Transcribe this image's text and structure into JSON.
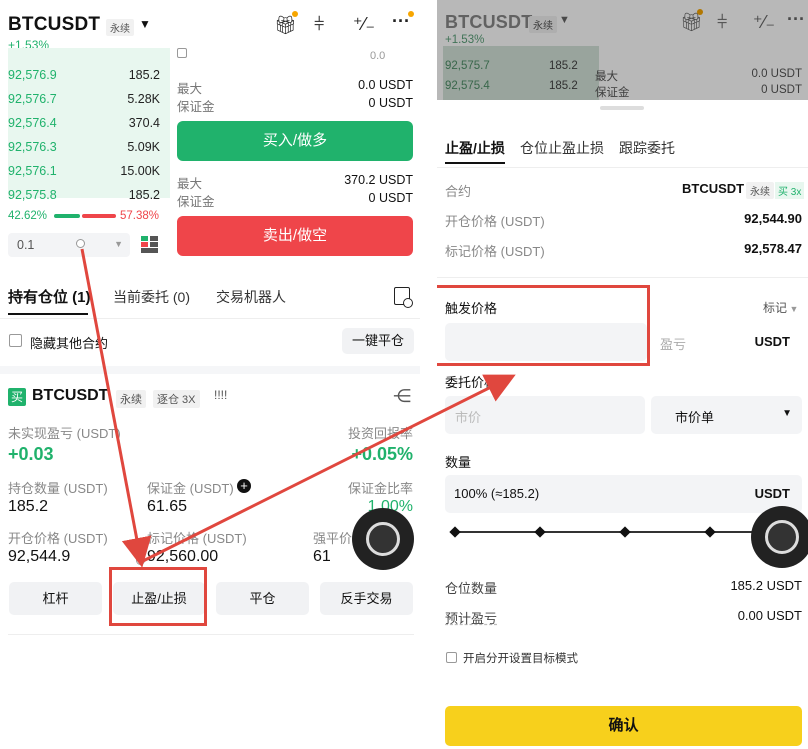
{
  "left": {
    "symbol": "BTCUSDT",
    "contract_tag": "永续",
    "change": "+1.53%",
    "orderbook": [
      {
        "price": "92,576.9",
        "qty": "185.2",
        "depth": 0.5
      },
      {
        "price": "92,576.7",
        "qty": "5.28K",
        "depth": 0.55
      },
      {
        "price": "92,576.4",
        "qty": "370.4",
        "depth": 0.55
      },
      {
        "price": "92,576.3",
        "qty": "5.09K",
        "depth": 0.55
      },
      {
        "price": "92,576.1",
        "qty": "15.00K",
        "depth": 0.55
      },
      {
        "price": "92,575.8",
        "qty": "185.2",
        "depth": 0.5
      }
    ],
    "ratio_buy": "42.62%",
    "ratio_sell": "57.38%",
    "qty_select": "0.1",
    "top_partial": "0.0",
    "max_label": "最大",
    "max_buy": "0.0 USDT",
    "margin_label": "保证金",
    "margin_buy": "0 USDT",
    "buy_button": "买入/做多",
    "max_sell": "370.2 USDT",
    "margin_sell": "0 USDT",
    "sell_button": "卖出/做空",
    "tabs": [
      "持有仓位 (1)",
      "当前委托 (0)",
      "交易机器人"
    ],
    "hide_other": "隐藏其他合约",
    "close_all": "一键平仓",
    "position": {
      "side": "买",
      "symbol": "BTCUSDT",
      "tag1": "永续",
      "tag2": "逐仓 3X",
      "marks": "!!!!",
      "upnl_label": "未实现盈亏 (USDT)",
      "upnl": "+0.03",
      "roe_label": "投资回报率",
      "roe": "+0.05%",
      "size_label": "持仓数量 (USDT)",
      "size": "185.2",
      "margin_label": "保证金 (USDT)",
      "margin": "61.65",
      "margin_ratio_label": "保证金比率",
      "margin_ratio": "1.00%",
      "entry_label": "开仓价格 (USDT)",
      "entry": "92,544.9",
      "mark_label": "标记价格 (USDT)",
      "mark": "92,560.00",
      "liq_label": "强平价格",
      "liq": "61",
      "buttons": [
        "杠杆",
        "止盈/止损",
        "平仓",
        "反手交易"
      ]
    }
  },
  "right": {
    "symbol": "BTCUSDT",
    "contract_tag": "永续",
    "change": "+1.53%",
    "bg_rows": [
      {
        "price": "92,575.7",
        "qty": "185.2",
        "label": "最大",
        "value": "0.0 USDT"
      },
      {
        "price": "92,575.4",
        "qty": "185.2",
        "label": "保证金",
        "value": "0 USDT"
      }
    ],
    "tabs": [
      "止盈/止损",
      "仓位止盈止损",
      "跟踪委托"
    ],
    "contract_label": "合约",
    "contract_value": "BTCUSDT",
    "contract_side": "买 3x",
    "entry_label": "开仓价格 (USDT)",
    "entry_value": "92,544.90",
    "mark_label": "标记价格 (USDT)",
    "mark_value": "92,578.47",
    "trigger_label": "触发价格",
    "trigger_type": "标记",
    "pnl_placeholder": "盈亏",
    "pnl_unit": "USDT",
    "order_price_label": "委托价格",
    "market_placeholder": "市价",
    "order_type": "市价单",
    "qty_label": "数量",
    "qty_value": "100% (≈185.2)",
    "qty_unit": "USDT",
    "slider_fraction": 1.0,
    "pos_qty_label": "仓位数量",
    "pos_qty_value": "185.2 USDT",
    "est_pnl_label": "预计盈亏",
    "est_pnl_value": "0.00 USDT",
    "split_label": "开启分开设置目标模式",
    "confirm": "确认"
  },
  "colors": {
    "green": "#20b26c",
    "red": "#ef454a",
    "yellow": "#f7d01c",
    "annotation": "#e0473e"
  }
}
